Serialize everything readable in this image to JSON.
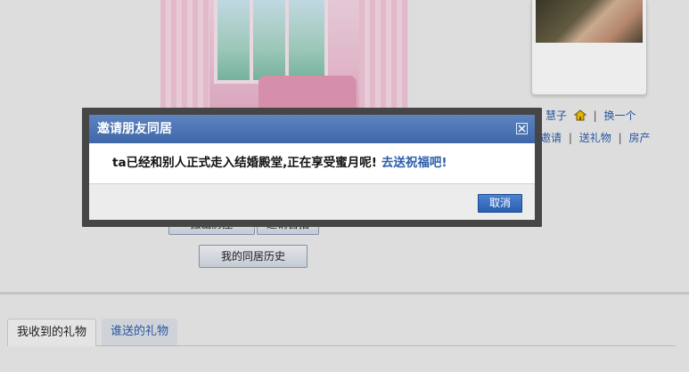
{
  "friend_panel": {
    "name": "慧子",
    "change_link": "换一个",
    "invite_link": "邀请",
    "gift_link": "送礼物",
    "property_link": "房产"
  },
  "room_actions": {
    "leave_label": "搬出房屋",
    "invite_label": "邀请首拍",
    "history_label": "我的同居历史"
  },
  "gift_tabs": {
    "received": "我收到的礼物",
    "sent": "谁送的礼物"
  },
  "dialog": {
    "title": "邀请朋友同居",
    "message": "ta已经和别人正式走入结婚殿堂,正在享受蜜月呢!",
    "bless_link": "去送祝福吧!",
    "cancel_label": "取消"
  },
  "colors": {
    "header_blue": "#4a72b3",
    "link_blue": "#2a5da8",
    "frame_dark": "#464646"
  }
}
